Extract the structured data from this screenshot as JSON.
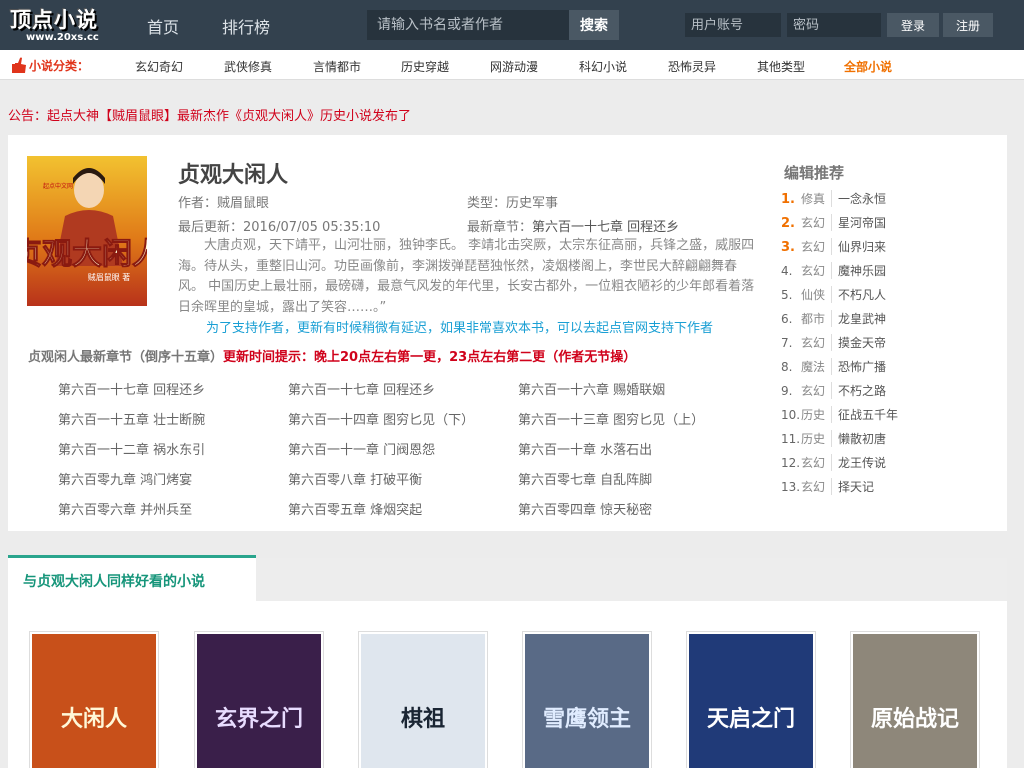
{
  "header": {
    "logo_text": "顶点小说",
    "logo_url": "www.20xs.cc",
    "nav": [
      "首页",
      "排行榜"
    ],
    "search_placeholder": "请输入书名或者作者",
    "search_button": "搜索",
    "username_placeholder": "用户账号",
    "password_placeholder": "密码",
    "login_button": "登录",
    "register_button": "注册"
  },
  "categories": {
    "label": "小说分类：",
    "items": [
      "玄幻奇幻",
      "武侠修真",
      "言情都市",
      "历史穿越",
      "网游动漫",
      "科幻小说",
      "恐怖灵异",
      "其他类型"
    ],
    "all": "全部小说"
  },
  "notice": "公告：起点大神【贼眉鼠眼】最新杰作《贞观大闲人》历史小说发布了",
  "book": {
    "title": "贞观大闲人",
    "author": "作者：贼眉鼠眼",
    "type": "类型：历史军事",
    "updated": "最后更新：2016/07/05 05:35:10",
    "latest_label": "最新章节：",
    "latest_chapter": "第六百一十七章 回程还乡",
    "description": "大唐贞观，天下靖平，山河壮丽，独钟李氏。 李靖北击突厥，太宗东征高丽，兵锋之盛，威服四海。待从头，重整旧山河。功臣画像前，李渊拨弹琵琶独怅然，凌烟楼阁上，李世民大醉翩翩舞春风。 中国历史上最壮丽，最磅礴，最意气风发的年代里，长安古都外，一位粗衣陋衫的少年郎看着落日余晖里的皇城，露出了笑容……。”",
    "support_note": "为了支持作者，更新有时候稍微有延迟，如果非常喜欢本书，可以去起点官网支持下作者",
    "chapters_heading": "贞观闲人最新章节（倒序十五章）",
    "update_tip": "更新时间提示：晚上20点左右第一更，23点左右第二更（作者无节操）",
    "chapters": [
      "第六百一十七章 回程还乡",
      "第六百一十七章 回程还乡",
      "第六百一十六章 赐婚联姻",
      "第六百一十五章 壮士断腕",
      "第六百一十四章 图穷匕见（下）",
      "第六百一十三章 图穷匕见（上）",
      "第六百一十二章 祸水东引",
      "第六百一十一章 门阀恩怨",
      "第六百一十章 水落石出",
      "第六百零九章 鸿门烤宴",
      "第六百零八章 打破平衡",
      "第六百零七章 自乱阵脚",
      "第六百零六章 并州兵至",
      "第六百零五章 烽烟突起",
      "第六百零四章 惊天秘密"
    ],
    "cover_text": "贞观大闲人",
    "cover_author": "贼眉鼠眼 著",
    "cover_publisher": "起点中文网"
  },
  "editor_picks": {
    "title": "编辑推荐",
    "items": [
      {
        "rank": "1.",
        "cat": "修真",
        "name": "一念永恒"
      },
      {
        "rank": "2.",
        "cat": "玄幻",
        "name": "星河帝国"
      },
      {
        "rank": "3.",
        "cat": "玄幻",
        "name": "仙界归来"
      },
      {
        "rank": "4.",
        "cat": "玄幻",
        "name": "魔神乐园"
      },
      {
        "rank": "5.",
        "cat": "仙侠",
        "name": "不朽凡人"
      },
      {
        "rank": "6.",
        "cat": "都市",
        "name": "龙皇武神"
      },
      {
        "rank": "7.",
        "cat": "玄幻",
        "name": "摸金天帝"
      },
      {
        "rank": "8.",
        "cat": "魔法",
        "name": "恐怖广播"
      },
      {
        "rank": "9.",
        "cat": "玄幻",
        "name": "不朽之路"
      },
      {
        "rank": "10.",
        "cat": "历史",
        "name": "征战五千年"
      },
      {
        "rank": "11.",
        "cat": "历史",
        "name": "懒散初唐"
      },
      {
        "rank": "12.",
        "cat": "玄幻",
        "name": "龙王传说"
      },
      {
        "rank": "13.",
        "cat": "玄幻",
        "name": "择天记"
      }
    ]
  },
  "similar": {
    "title": "与贞观大闲人同样好看的小说",
    "covers": [
      {
        "text": "大闲人",
        "bg": "#c8501a",
        "fg": "#fff8d8"
      },
      {
        "text": "玄界之门",
        "bg": "#3a1f4a",
        "fg": "#e8dcff"
      },
      {
        "text": "棋祖",
        "bg": "#dfe6ee",
        "fg": "#1a2533"
      },
      {
        "text": "雪鹰领主",
        "bg": "#596a86",
        "fg": "#e0ecff"
      },
      {
        "text": "天启之门",
        "bg": "#203a78",
        "fg": "#ffffff"
      },
      {
        "text": "原始战记",
        "bg": "#8e877a",
        "fg": "#ffffff"
      }
    ]
  }
}
